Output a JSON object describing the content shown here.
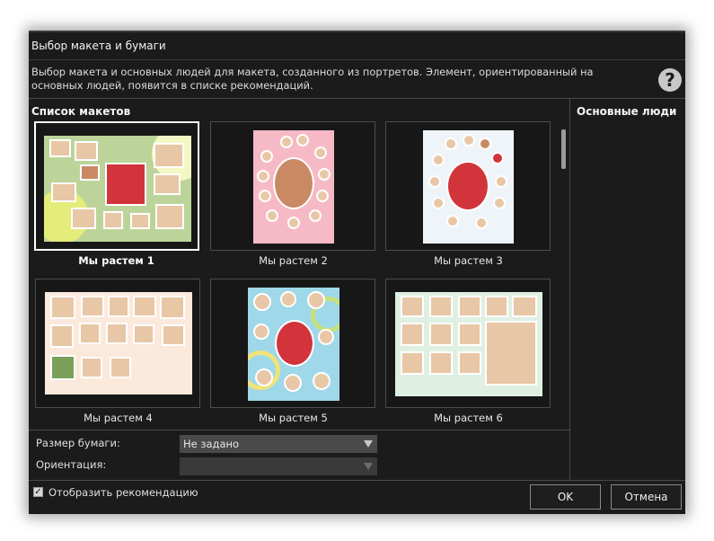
{
  "dialog": {
    "title": "Выбор макета и бумаги",
    "description": "Выбор макета и основных людей для макета, созданного из портретов. Элемент, ориентированный на основных людей, появится в списке рекомендаций.",
    "help_icon": "question-icon",
    "help_glyph": "?"
  },
  "layouts": {
    "title": "Список макетов",
    "items": [
      {
        "label": "Мы растем 1",
        "selected": true,
        "background": "#f3efc8"
      },
      {
        "label": "Мы растем 2",
        "selected": false,
        "background": "#f6b9c6"
      },
      {
        "label": "Мы растем 3",
        "selected": false,
        "background": "#eef4f8"
      },
      {
        "label": "Мы растем 4",
        "selected": false,
        "background": "#fbe9dc"
      },
      {
        "label": "Мы растем 5",
        "selected": false,
        "background": "#9fd8e8"
      },
      {
        "label": "Мы растем 6",
        "selected": false,
        "background": "#dff0e2"
      }
    ]
  },
  "people": {
    "title": "Основные люди"
  },
  "paper": {
    "size_label": "Размер бумаги:",
    "size_value": "Не задано",
    "orientation_label": "Ориентация:",
    "orientation_value": ""
  },
  "footer": {
    "checkbox_label": "Отобразить рекомендацию",
    "checkbox_checked": true,
    "checkbox_glyph": "✓",
    "ok_label": "OK",
    "cancel_label": "Отмена"
  }
}
